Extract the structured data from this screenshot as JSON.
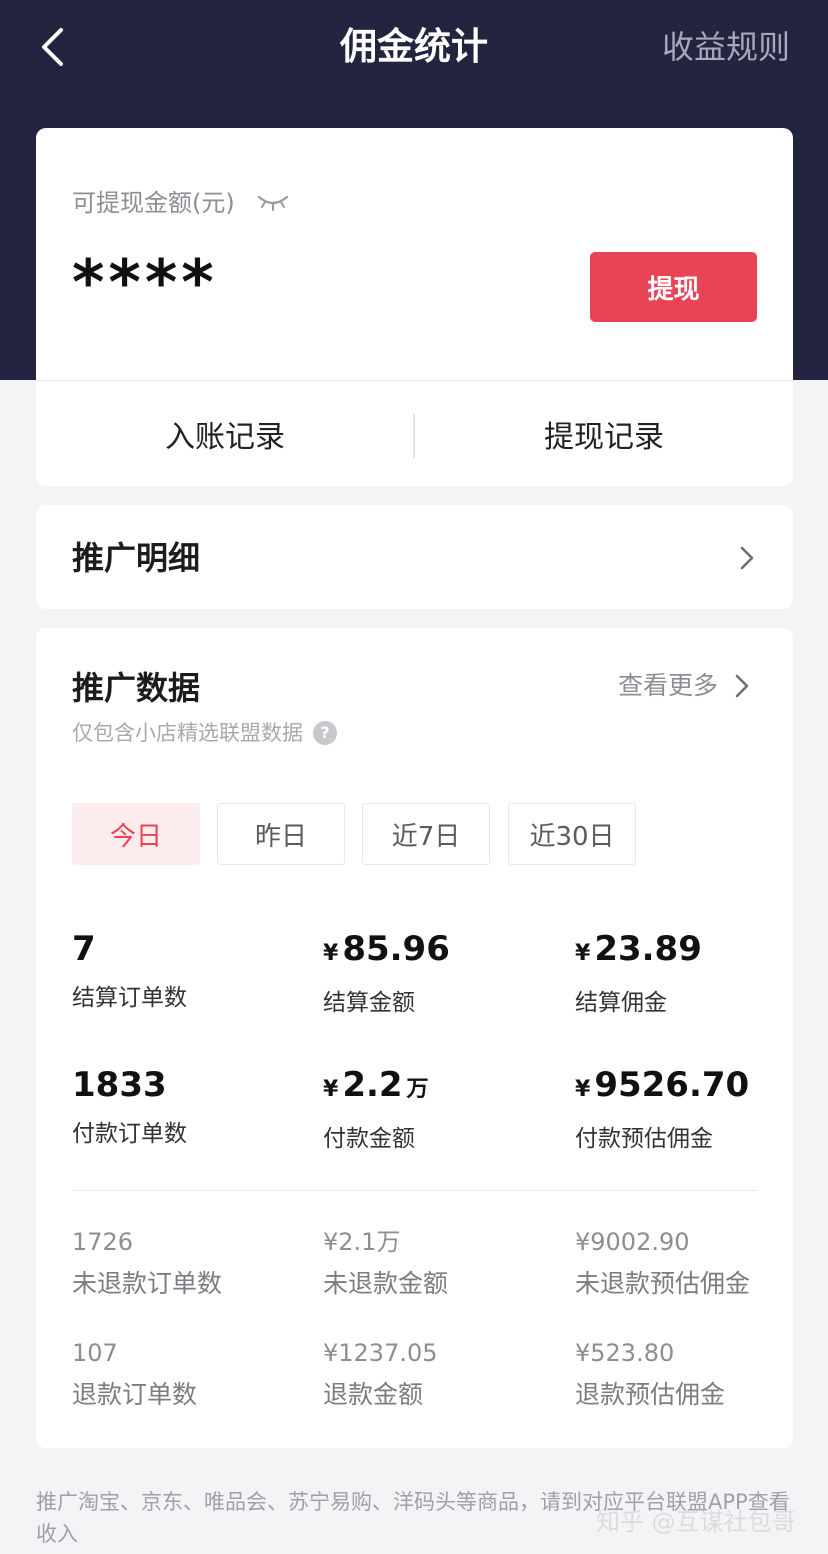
{
  "nav": {
    "title": "佣金统计",
    "rules_label": "收益规则"
  },
  "wallet": {
    "balance_label": "可提现金额(元)",
    "balance_value": "****",
    "withdraw_label": "提现",
    "income_records_label": "入账记录",
    "withdraw_records_label": "提现记录"
  },
  "detail": {
    "title": "推广明细"
  },
  "data_section": {
    "title": "推广数据",
    "more_label": "查看更多",
    "subtitle": "仅包含小店精选联盟数据",
    "tabs": [
      {
        "label": "今日",
        "active": true
      },
      {
        "label": "昨日",
        "active": false
      },
      {
        "label": "近7日",
        "active": false
      },
      {
        "label": "近30日",
        "active": false
      }
    ],
    "stats": [
      {
        "currency": "",
        "value": "7",
        "unit": "",
        "label": "结算订单数"
      },
      {
        "currency": "¥",
        "value": "85.96",
        "unit": "",
        "label": "结算金额"
      },
      {
        "currency": "¥",
        "value": "23.89",
        "unit": "",
        "label": "结算佣金"
      },
      {
        "currency": "",
        "value": "1833",
        "unit": "",
        "label": "付款订单数"
      },
      {
        "currency": "¥",
        "value": "2.2",
        "unit": "万",
        "label": "付款金额"
      },
      {
        "currency": "¥",
        "value": "9526.70",
        "unit": "",
        "label": "付款预估佣金"
      }
    ],
    "minor_stats": [
      {
        "value": "1726",
        "label": "未退款订单数"
      },
      {
        "value": "¥2.1万",
        "label": "未退款金额"
      },
      {
        "value": "¥9002.90",
        "label": "未退款预估佣金"
      },
      {
        "value": "107",
        "label": "退款订单数"
      },
      {
        "value": "¥1237.05",
        "label": "退款金额"
      },
      {
        "value": "¥523.80",
        "label": "退款预估佣金"
      }
    ]
  },
  "footnote": "推广淘宝、京东、唯品会、苏宁易购、洋码头等商品，请到对应平台联盟APP查看收入",
  "watermark": "知乎 @互谋社包哥",
  "colors": {
    "header_bg": "#23243f",
    "accent": "#e94456",
    "active_tab_bg": "#fdecee"
  },
  "icons": [
    "back-arrow-icon",
    "eye-closed-icon",
    "chevron-right-icon",
    "help-icon"
  ]
}
